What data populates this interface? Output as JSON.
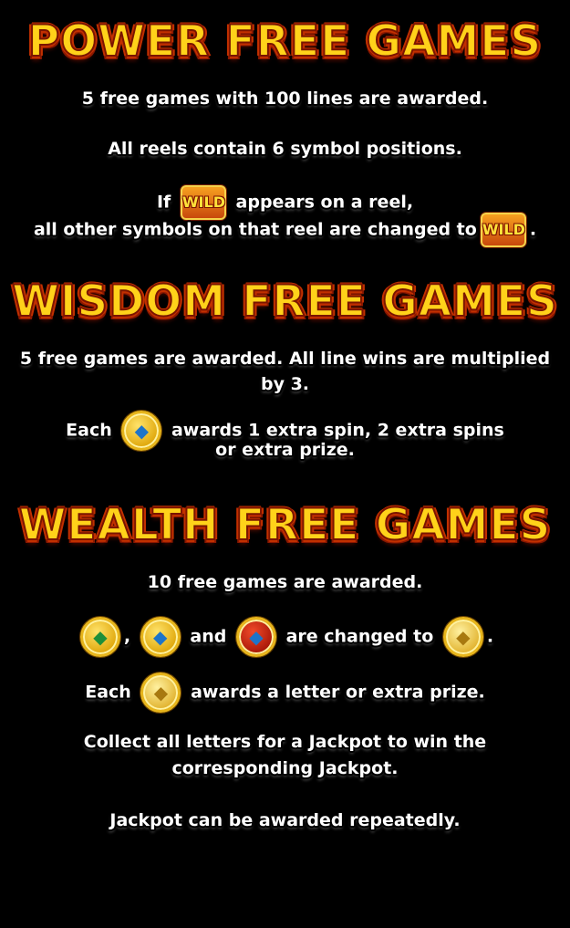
{
  "power": {
    "title": "POWER FREE GAMES",
    "line1": "5 free games with 100 lines are awarded.",
    "line2": "All reels contain 6 symbol positions.",
    "line3a": "If",
    "line3b": "appears on a reel,",
    "line4": "all other symbols on that reel are changed to",
    "wild_label": "WILD"
  },
  "wisdom": {
    "title": "WISDOM FREE GAMES",
    "line1": "5 free games are awarded. All line wins are multiplied",
    "line2": "by 3.",
    "line3a": "Each",
    "line3b": "awards 1 extra spin, 2 extra spins",
    "line4": "or extra prize."
  },
  "wealth": {
    "title": "WEALTH FREE GAMES",
    "line1": "10 free games are awarded.",
    "line2_and": "and",
    "line2_changed": "are changed to",
    "line3a": "Each",
    "line3b": "awards a letter or extra prize.",
    "line4": "Collect all letters for a Jackpot to win the",
    "line5": "corresponding Jackpot.",
    "line6": "Jackpot can be awarded repeatedly."
  },
  "icons": {
    "wild": "wild-symbol-icon",
    "coin_blue": "blue-coin-icon",
    "coin_green": "green-coin-icon",
    "coin_red": "red-coin-icon",
    "coin_gold": "gold-coin-icon"
  },
  "colors": {
    "title_fill": "#ffd21a",
    "title_outline": "#c23000",
    "text": "#ffffff",
    "background": "#000000"
  }
}
